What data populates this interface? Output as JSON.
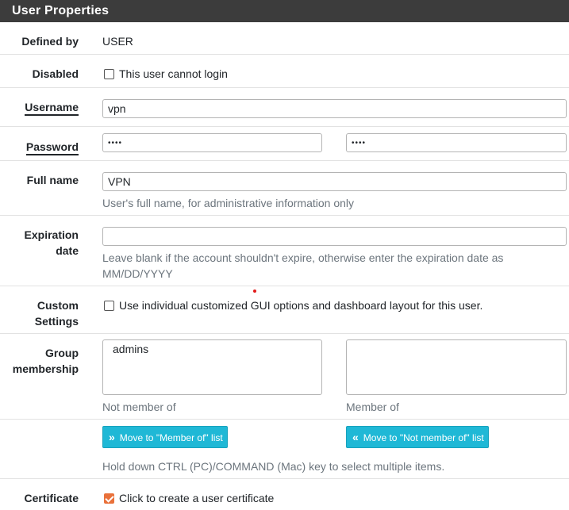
{
  "panel": {
    "title": "User Properties"
  },
  "defined_by": {
    "label": "Defined by",
    "value": "USER"
  },
  "disabled": {
    "label": "Disabled",
    "checkbox_label": "This user cannot login",
    "checked": false
  },
  "username": {
    "label": "Username",
    "value": "vpn"
  },
  "password": {
    "label": "Password",
    "value": "••••",
    "confirm_value": "••••"
  },
  "full_name": {
    "label": "Full name",
    "value": "VPN",
    "help": "User's full name, for administrative information only"
  },
  "expiration": {
    "label_line1": "Expiration",
    "label_line2": "date",
    "value": "",
    "help_line1": "Leave blank if the account shouldn't expire, otherwise enter the expiration date as",
    "help_line2": "MM/DD/YYYY"
  },
  "custom_settings": {
    "label_line1": "Custom",
    "label_line2": "Settings",
    "checkbox_label": "Use individual customized GUI options and dashboard layout for this user.",
    "checked": false
  },
  "group_membership": {
    "label_line1": "Group",
    "label_line2": "membership",
    "not_member_items": [
      "admins"
    ],
    "member_items": [],
    "not_member_caption": "Not member of",
    "member_caption": "Member of"
  },
  "move_buttons": {
    "to_member_label": "Move to \"Member of\" list",
    "to_not_member_label": "Move to \"Not member of\" list",
    "help": "Hold down CTRL (PC)/COMMAND (Mac) key to select multiple items."
  },
  "certificate": {
    "label": "Certificate",
    "checkbox_label": "Click to create a user certificate",
    "checked": true
  },
  "colors": {
    "header_bg": "#3c3c3c",
    "button_bg": "#1fb8d6",
    "checkbox_checked": "#e9713a",
    "help_text": "#6c757d"
  },
  "icons": {
    "move_right": "double-chevron-right-icon",
    "move_left": "double-chevron-left-icon"
  }
}
